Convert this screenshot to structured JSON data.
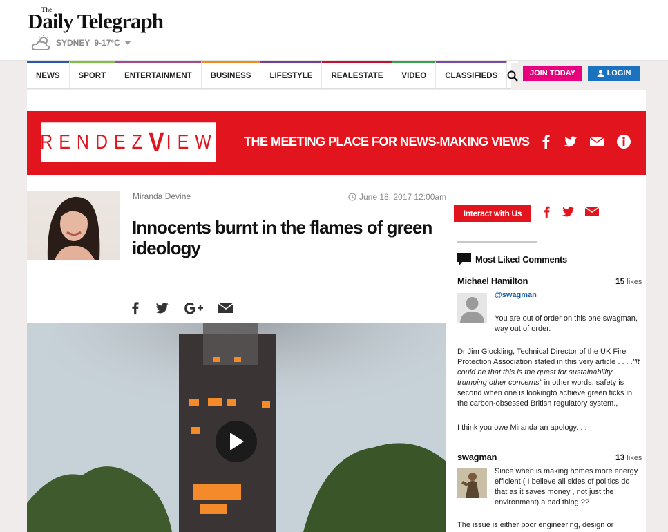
{
  "site": {
    "logo_small": "The",
    "logo_name": "Daily Telegraph",
    "city": "SYDNEY",
    "temp": "9-17°C"
  },
  "nav": {
    "items": [
      {
        "label": "NEWS",
        "color": "#2a57a7"
      },
      {
        "label": "SPORT",
        "color": "#7ec242"
      },
      {
        "label": "ENTERTAINMENT",
        "color": "#a04a9c"
      },
      {
        "label": "BUSINESS",
        "color": "#ef8a1f"
      },
      {
        "label": "LIFESTYLE",
        "color": "#7a3d8f"
      },
      {
        "label": "REALESTATE",
        "color": "#c8102e"
      },
      {
        "label": "VIDEO",
        "color": "#3aa34a"
      },
      {
        "label": "CLASSIFIEDS",
        "color": "#7b4aa0"
      }
    ],
    "join": "JOIN TODAY",
    "login": "LOGIN"
  },
  "banner": {
    "logo_left": "RENDEZ",
    "logo_v": "V",
    "logo_right": "IEW",
    "tagline": "THE MEETING PLACE FOR NEWS-MAKING VIEWS"
  },
  "article": {
    "author": "Miranda Devine",
    "date": "June 18, 2017 12:00am",
    "headline": "Innocents burnt in the flames of green ideology"
  },
  "sidebar": {
    "interact": "Interact with Us",
    "most_liked": "Most Liked Comments",
    "comments": [
      {
        "name": "Michael Hamilton",
        "likes": "15",
        "likes_label": "likes",
        "handle": "@swagman",
        "reply": "You are out of order on this one swagman, way out of order.",
        "p1_a": "Dr Jim Glockling, Technical Director of the UK Fire Protection Association stated in this very article . . . .",
        "p1_quote": "\"It could be that this is the quest for sustainability trumping other concerns\"",
        "p1_b": " in other words, safety is second when one is lookingto achieve green ticks in the carbon-obsessed British regulatory system.,",
        "p2": "I think you owe Miranda an apology. . ."
      },
      {
        "name": "swagman",
        "likes": "13",
        "likes_label": "likes",
        "text": "Since when is making homes more energy efficient ( I believe all sides of politics do that as it saves money , not just the environment) a bad thing ??",
        "p2": "The issue is either poor engineering, design or"
      }
    ]
  }
}
